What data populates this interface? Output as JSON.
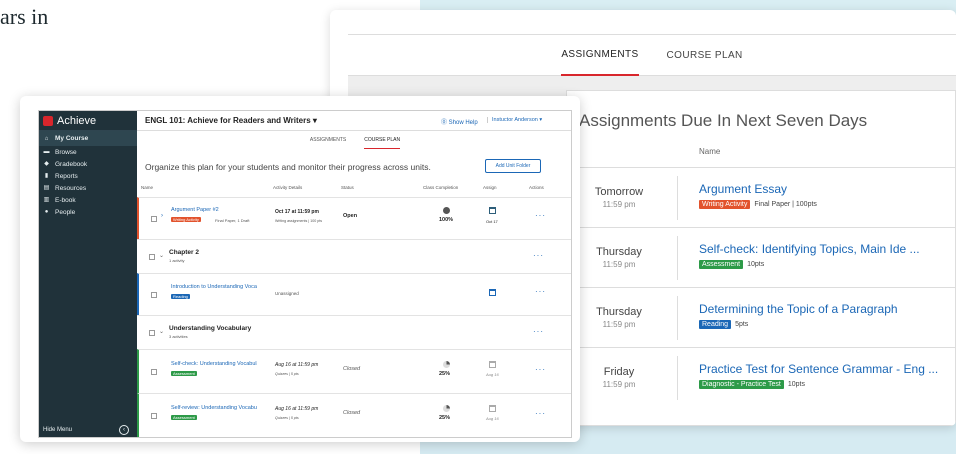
{
  "page": {
    "hero_text": "ars in"
  },
  "assignments_window": {
    "tabs": [
      {
        "label": "ASSIGNMENTS",
        "active": true
      },
      {
        "label": "COURSE PLAN",
        "active": false
      }
    ],
    "title": "Assignments Due In Next Seven Days",
    "column_name": "Name",
    "rows": [
      {
        "day": "Tomorrow",
        "time": "11:59 pm",
        "name": "Argument Essay",
        "badge": "Writing Activity",
        "badge_color": "#e2532d",
        "meta": "Final Paper | 100pts"
      },
      {
        "day": "Thursday",
        "time": "11:59 pm",
        "name": "Self-check: Identifying Topics, Main Ide ...",
        "badge": "Assessment",
        "badge_color": "#2d9a48",
        "meta": "10pts"
      },
      {
        "day": "Thursday",
        "time": "11:59 pm",
        "name": "Determining the Topic of a Paragraph",
        "badge": "Reading",
        "badge_color": "#1b67b6",
        "meta": "5pts"
      },
      {
        "day": "Friday",
        "time": "11:59 pm",
        "name": "Practice Test for Sentence Grammar - Eng ...",
        "badge": "Diagnostic - Practice Test",
        "badge_color": "#2d9a48",
        "meta": "10pts"
      }
    ]
  },
  "course_window": {
    "logo_text": "Achieve",
    "sidebar": {
      "items": [
        {
          "label": "My Course",
          "icon": "home-icon",
          "glyph": "⌂",
          "active": true
        },
        {
          "label": "Browse",
          "icon": "folder-icon",
          "glyph": "▬",
          "active": false
        },
        {
          "label": "Gradebook",
          "icon": "graduation-cap-icon",
          "glyph": "◆",
          "active": false
        },
        {
          "label": "Reports",
          "icon": "bar-chart-icon",
          "glyph": "▮",
          "active": false
        },
        {
          "label": "Resources",
          "icon": "book-icon",
          "glyph": "▤",
          "active": false
        },
        {
          "label": "E-book",
          "icon": "ebook-icon",
          "glyph": "▥",
          "active": false
        },
        {
          "label": "People",
          "icon": "people-icon",
          "glyph": "●",
          "active": false
        }
      ],
      "hide_menu": "Hide Menu"
    },
    "course_title": "ENGL 101: Achieve for Readers and Writers ▾",
    "show_help": "⓪ Show Help",
    "instructor": "Instuctor Anderson ▾",
    "tabs": [
      {
        "label": "ASSIGNMENTS",
        "active": false
      },
      {
        "label": "COURSE PLAN",
        "active": true
      }
    ],
    "organize_text": "Organize this plan for your students and monitor their progress across units.",
    "add_folder": "Add Unit Folder",
    "columns": {
      "name": "Name",
      "activity": "Activity Details",
      "status": "Status",
      "completion": "Class Completion",
      "assign": "Assign",
      "actions": "Actions"
    },
    "rows": {
      "argument": {
        "title": "Argument Paper #2",
        "badge": "Writing Activity",
        "meta": "Final Paper, 1 Draft",
        "date": "Oct 17 at 11:59 pm",
        "sub": "Writing assignments | 100 pts",
        "status": "Open",
        "completion": "100%",
        "assign_date": "Oct 17"
      },
      "chapter": {
        "title": "Chapter 2",
        "sub": "1 activity"
      },
      "intro": {
        "title": "Introduction to Understanding Vocabulary",
        "badge": "Reading",
        "status": "Unassigned"
      },
      "vocab": {
        "title": "Understanding Vocabulary",
        "sub": "3 activities"
      },
      "selfcheck": {
        "title": "Self-check: Understanding Vocabulary",
        "badge": "Assessment",
        "date": "Aug 16 at 11:59 pm",
        "sub": "Quizzes | 5 pts",
        "status": "Closed",
        "completion": "25%",
        "assign_date": "Aug 16"
      },
      "selfreview": {
        "title": "Self-review: Understanding Vocabulary",
        "badge": "Assessment",
        "date": "Aug 16 at 11:59 pm",
        "sub": "Quizzes | 5 pts",
        "status": "Closed",
        "completion": "25%",
        "assign_date": "Aug 16"
      }
    },
    "actions_glyph": "···",
    "check_pie_color": "#555555"
  }
}
